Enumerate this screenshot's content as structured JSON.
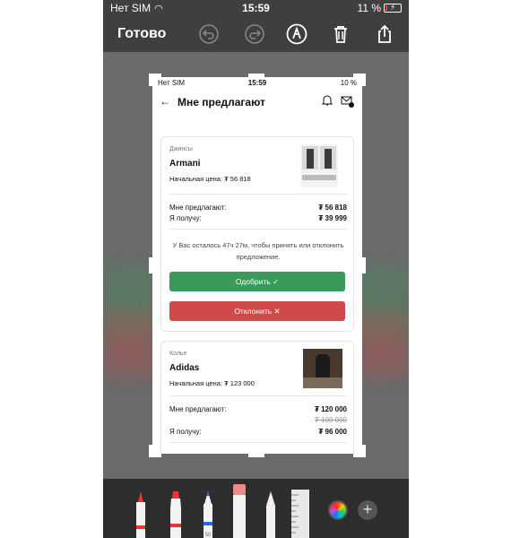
{
  "device_status": {
    "carrier": "Нет SIM",
    "time": "15:59",
    "battery": "11 %"
  },
  "markup_toolbar": {
    "done_label": "Готово"
  },
  "screenshot": {
    "status": {
      "carrier": "Нет SIM",
      "time": "15:59",
      "battery": "10 %"
    },
    "header": {
      "title": "Мне предлагают"
    },
    "offers": [
      {
        "category": "Джинсы",
        "brand": "Armani",
        "initial_price": "Начальная цена: ₮ 56 818",
        "offered_label": "Мне предлагают:",
        "offered_value": "₮ 56 818",
        "receive_label": "Я получу:",
        "receive_value": "₮ 39 999",
        "note": "У Вас осталось 47ч 27м, чтобы принять или отклонить предложение.",
        "accept_label": "Одобрить ✓",
        "decline_label": "Отклонить ✕"
      },
      {
        "category": "Колье",
        "brand": "Adidas",
        "initial_price": "Начальная цена: ₮ 123 000",
        "offered_label": "Мне предлагают:",
        "offered_value": "₮ 120 000",
        "old_value": "₮ 100 000",
        "receive_label": "Я получу:",
        "receive_value": "₮ 96 000"
      }
    ]
  },
  "tools": [
    "pen-tool",
    "marker-tool",
    "pencil-tool",
    "eraser-tool",
    "lasso-tool",
    "ruler-tool",
    "color-picker",
    "add-button"
  ],
  "colors": {
    "accept": "#3a9a5a",
    "decline": "#d04a4a",
    "toolbar": "#3f3f3f"
  }
}
